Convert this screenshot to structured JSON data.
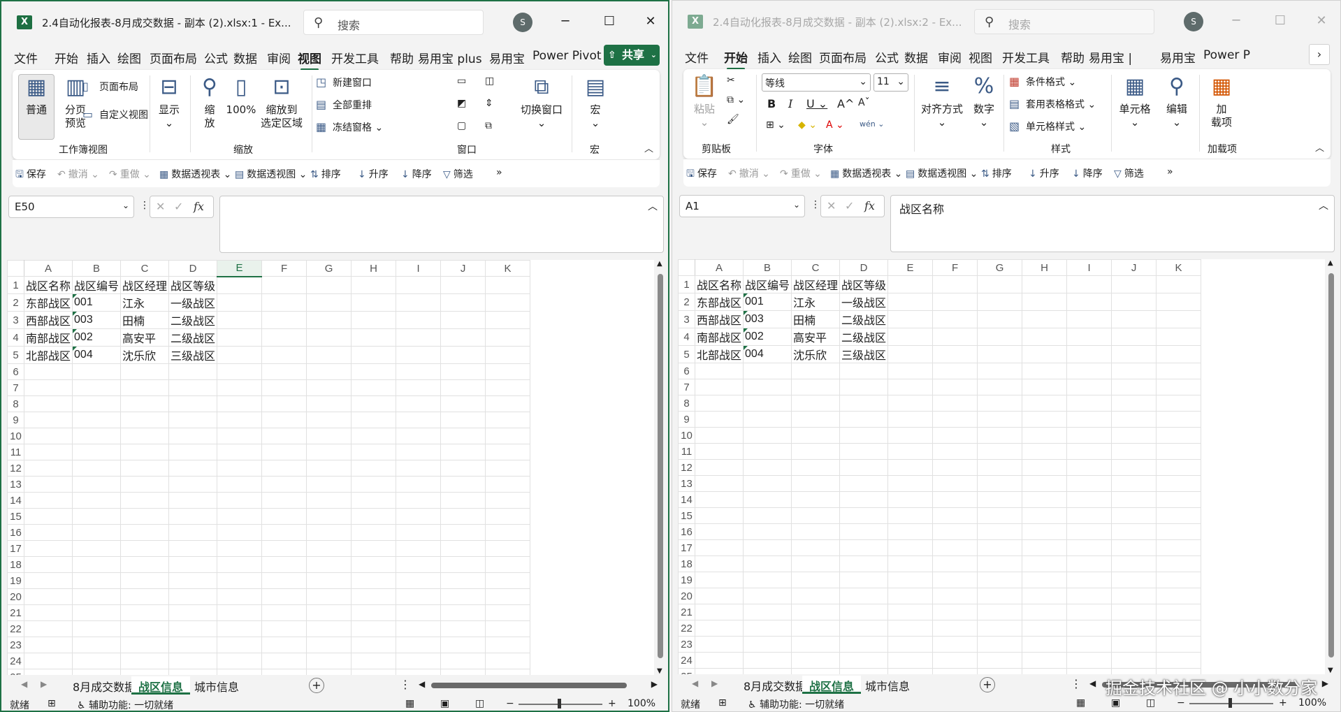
{
  "left": {
    "title": "2.4自动化报表-8月成交数据 - 副本 (2).xlsx:1  -  Ex...",
    "search_placeholder": "搜索",
    "avatar": "S",
    "tabs": [
      "文件",
      "开始",
      "插入",
      "绘图",
      "页面布局",
      "公式",
      "数据",
      "审阅",
      "视图",
      "开发工具",
      "帮助",
      "易用宝 plus",
      "易用宝",
      "Power Pivot"
    ],
    "share_label": "共享",
    "ribbon": {
      "normal": "普通",
      "page_break": "分页\n预览",
      "page_layout": "页面布局",
      "custom_view": "自定义视图",
      "group_workbook_views": "工作簿视图",
      "show": "显示",
      "zoom": "缩\n放",
      "zoom100": "100%",
      "zoom_selection": "缩放到\n选定区域",
      "group_zoom": "缩放",
      "new_window": "新建窗口",
      "arrange_all": "全部重排",
      "freeze_panes": "冻结窗格",
      "switch_windows": "切换窗口",
      "group_window": "窗口",
      "macros": "宏",
      "group_macros": "宏"
    },
    "name_box": "E50",
    "formula": "",
    "active_sheet_index": 1
  },
  "right": {
    "title": "2.4自动化报表-8月成交数据 - 副本 (2).xlsx:2  -  Ex...",
    "search_placeholder": "搜索",
    "avatar": "S",
    "tabs": [
      "文件",
      "开始",
      "插入",
      "绘图",
      "页面布局",
      "公式",
      "数据",
      "审阅",
      "视图",
      "开发工具",
      "帮助",
      "易用宝 |",
      "易用宝",
      "Power P"
    ],
    "ribbon": {
      "paste": "粘贴",
      "group_clipboard": "剪贴板",
      "font_name": "等线",
      "font_size": "11",
      "group_font": "字体",
      "alignment": "对齐方式",
      "number": "数字",
      "cond_format": "条件格式",
      "table_format": "套用表格格式",
      "cell_styles": "单元格样式",
      "group_styles": "样式",
      "cells": "单元格",
      "editing": "编辑",
      "addins": "加\n载项",
      "group_addins": "加载项"
    },
    "name_box": "A1",
    "formula": "战区名称",
    "active_sheet_index": 1
  },
  "qat": {
    "save": "保存",
    "undo": "撤消",
    "redo": "重做",
    "pivot_table": "数据透视表",
    "pivot_chart": "数据透视图",
    "sort": "排序",
    "asc": "升序",
    "desc": "降序",
    "filter": "筛选",
    "more": "»"
  },
  "columns": [
    "A",
    "B",
    "C",
    "D",
    "E",
    "F",
    "G",
    "H",
    "I",
    "J",
    "K"
  ],
  "rows": [
    [
      "战区名称",
      "战区编号",
      "战区经理",
      "战区等级"
    ],
    [
      "东部战区",
      "001",
      "江永",
      "一级战区"
    ],
    [
      "西部战区",
      "003",
      "田楠",
      "二级战区"
    ],
    [
      "南部战区",
      "002",
      "高安平",
      "二级战区"
    ],
    [
      "北部战区",
      "004",
      "沈乐欣",
      "三级战区"
    ]
  ],
  "row_count": 25,
  "sheets": [
    "8月成交数据",
    "战区信息",
    "城市信息"
  ],
  "status": {
    "ready": "就绪",
    "accessibility": "辅助功能: 一切就绪",
    "zoom": "100%"
  },
  "watermark": "掘金技术社区 @ 小小数分家"
}
